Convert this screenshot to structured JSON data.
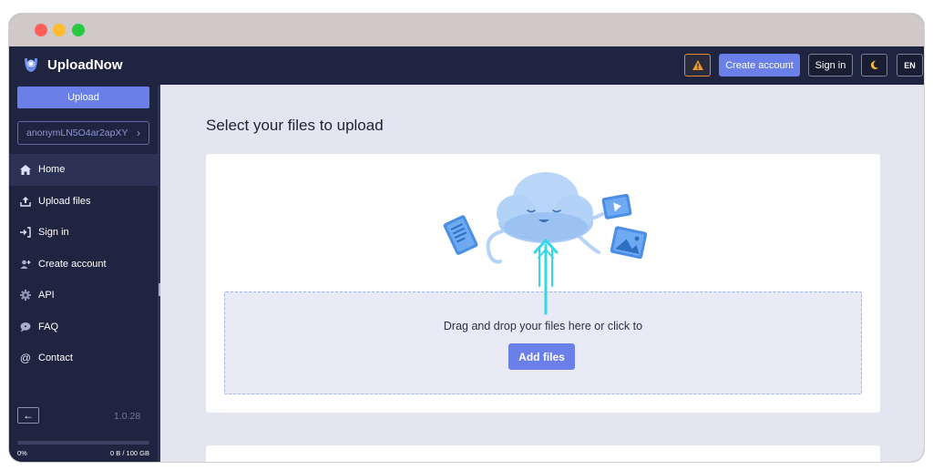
{
  "app": {
    "name": "UploadNow"
  },
  "header": {
    "create_account": "Create account",
    "sign_in": "Sign in",
    "language": "EN",
    "warning_icon": "warning-icon",
    "theme_icon": "moon-icon"
  },
  "sidebar": {
    "upload_button": "Upload",
    "user_id": "anonymLN5O4ar2apXY",
    "items": [
      {
        "label": "Home",
        "icon": "home-icon"
      },
      {
        "label": "Upload files",
        "icon": "upload-icon"
      },
      {
        "label": "Sign in",
        "icon": "sign-in-icon"
      },
      {
        "label": "Create account",
        "icon": "add-user-icon"
      },
      {
        "label": "API",
        "icon": "gear-icon"
      },
      {
        "label": "FAQ",
        "icon": "chat-bubble-icon"
      },
      {
        "label": "Contact",
        "icon": "at-icon"
      }
    ],
    "version": "1.0.28",
    "storage": {
      "percent_label": "0%",
      "used_label": "0 B / 100 GB",
      "fraction": 0
    }
  },
  "main": {
    "title": "Select your files to upload",
    "drop_text": "Drag and drop your files here or click to",
    "add_files": "Add files"
  },
  "colors": {
    "accent": "#6b7fe8",
    "sidebar": "#1f2440",
    "background": "#e3e6f1",
    "warning": "#e8862e"
  }
}
